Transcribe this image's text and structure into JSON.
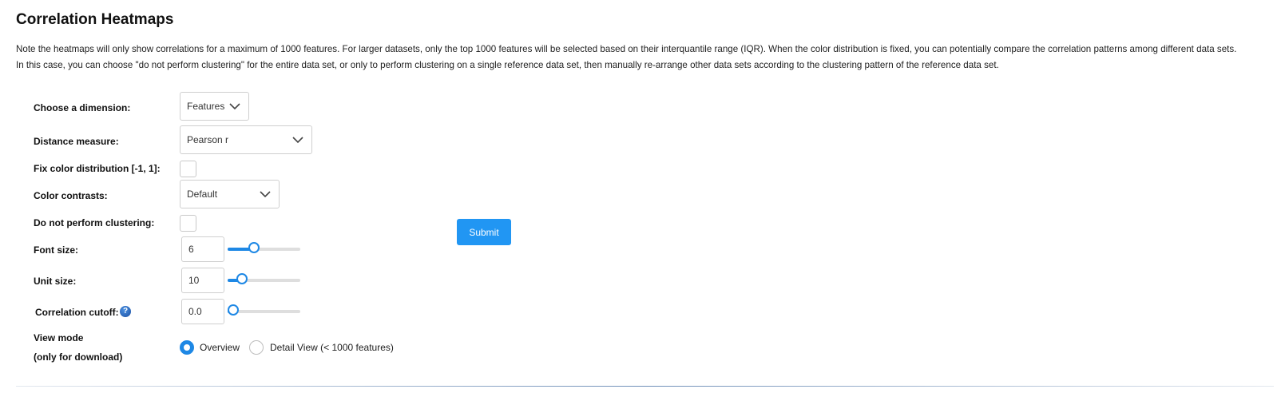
{
  "header": {
    "title": "Correlation Heatmaps",
    "note_line1": "Note the heatmaps will only show correlations for a maximum of 1000 features. For larger datasets, only the top 1000 features will be selected based on their interquantile range (IQR). When the color distribution is fixed, you can potentially compare the correlation patterns among different data sets.",
    "note_line2": "In this case, you can choose \"do not perform clustering\" for the entire data set, or only to perform clustering on a single reference data set, then manually re-arrange other data sets according to the clustering pattern of the reference data set."
  },
  "form": {
    "dimension": {
      "label": "Choose a dimension:",
      "value": "Features"
    },
    "distance": {
      "label": "Distance measure:",
      "value": "Pearson r"
    },
    "fix_color": {
      "label": "Fix color distribution [-1, 1]:",
      "checked": false
    },
    "contrast": {
      "label": "Color contrasts:",
      "value": "Default"
    },
    "no_cluster": {
      "label": "Do not perform clustering:",
      "checked": false
    },
    "font_size": {
      "label": "Font size:",
      "value": "6",
      "slider_fraction": 0.34
    },
    "unit_size": {
      "label": "Unit size:",
      "value": "10",
      "slider_fraction": 0.14
    },
    "cutoff": {
      "label": "Correlation cutoff:",
      "value": "0.0",
      "slider_fraction": 0.0,
      "help_icon": "question-circle-icon"
    },
    "view_mode": {
      "label_line1": "View mode",
      "label_line2": "(only for download)",
      "options": [
        "Overview",
        "Detail View (< 1000 features)"
      ],
      "selected": "Overview"
    },
    "submit_label": "Submit"
  },
  "colors": {
    "accent": "#1e88e5",
    "submit_bg": "#2196f3"
  }
}
